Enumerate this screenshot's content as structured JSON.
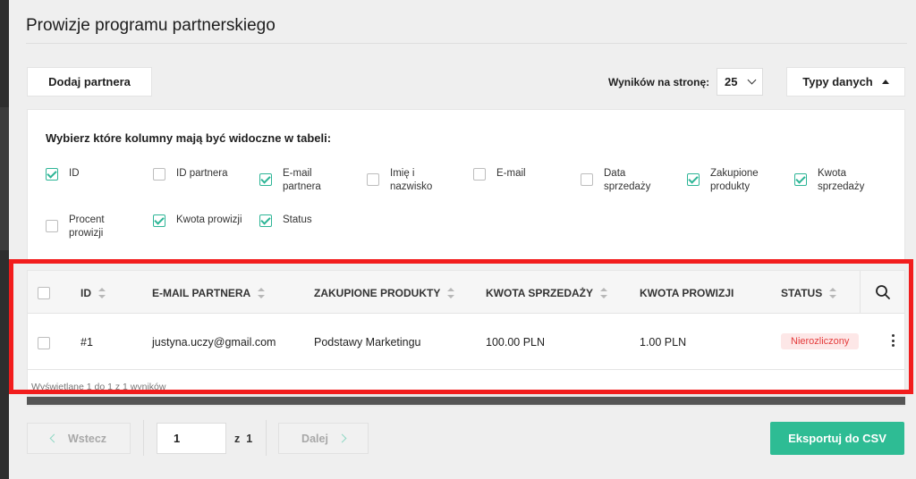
{
  "page": {
    "title": "Prowizje programu partnerskiego"
  },
  "toolbar": {
    "add_partner_label": "Dodaj partnera",
    "per_page_label": "Wyników na stronę:",
    "per_page_value": "25",
    "data_types_label": "Typy danych"
  },
  "columns_panel": {
    "title": "Wybierz które kolumny mają być widoczne w tabeli:",
    "options": [
      {
        "label": "ID",
        "checked": true
      },
      {
        "label": "ID partnera",
        "checked": false
      },
      {
        "label": "E-mail partnera",
        "checked": true
      },
      {
        "label": "Imię i nazwisko",
        "checked": false
      },
      {
        "label": "E-mail",
        "checked": false
      },
      {
        "label": "Data sprzedaży",
        "checked": false
      },
      {
        "label": "Zakupione produkty",
        "checked": true
      },
      {
        "label": "Kwota sprzedaży",
        "checked": true
      },
      {
        "label": "Procent prowizji",
        "checked": false
      },
      {
        "label": "Kwota prowizji",
        "checked": true
      },
      {
        "label": "Status",
        "checked": true
      }
    ]
  },
  "table": {
    "headers": [
      "ID",
      "E-MAIL PARTNERA",
      "ZAKUPIONE PRODUKTY",
      "KWOTA SPRZEDAŻY",
      "KWOTA PROWIZJI",
      "STATUS"
    ],
    "rows": [
      {
        "id": "#1",
        "email": "justyna.uczy@gmail.com",
        "products": "Podstawy Marketingu",
        "sale_amount": "100.00 PLN",
        "commission": "1.00 PLN",
        "status": "Nierozliczony"
      }
    ],
    "footer_info": "Wyświetlane 1 do 1 z 1 wyników"
  },
  "pagination": {
    "prev_label": "Wstecz",
    "next_label": "Dalej",
    "current_page": "1",
    "of_label": "z",
    "total_pages": "1"
  },
  "export_label": "Eksportuj do CSV",
  "colors": {
    "accent": "#2ebc94",
    "status_unsettled_bg": "#fde7e7",
    "status_unsettled_text": "#e43b3b",
    "highlight": "#f21d1d"
  }
}
